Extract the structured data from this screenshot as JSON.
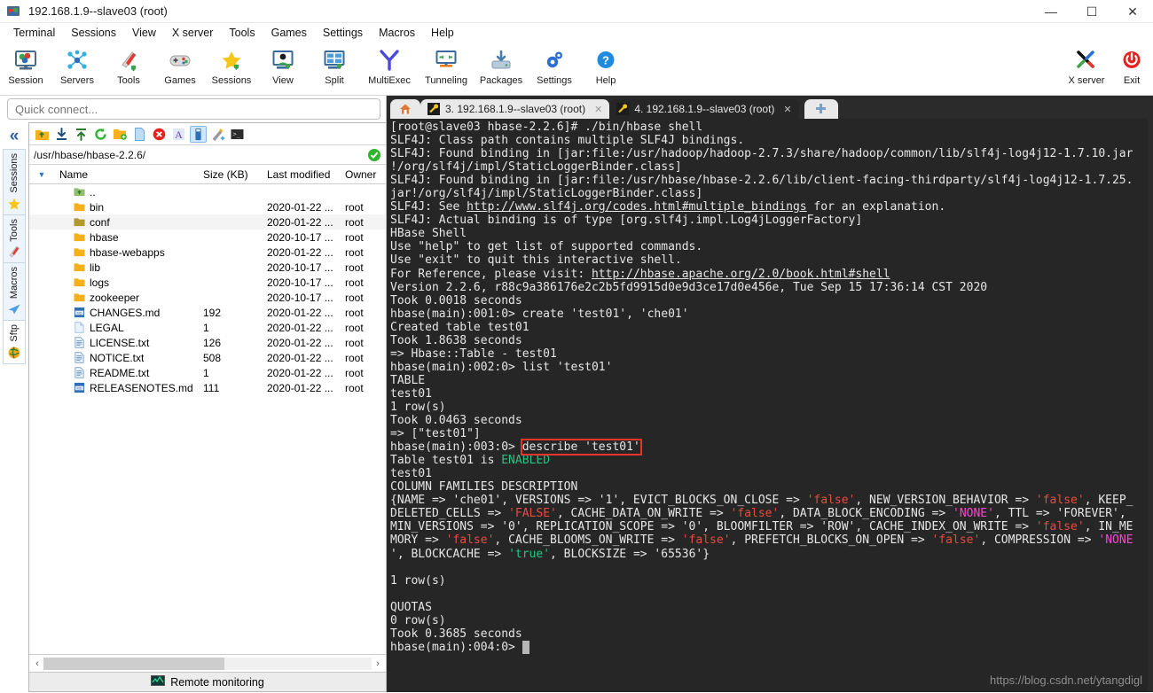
{
  "window": {
    "title": "192.168.1.9--slave03 (root)",
    "icon": "mobaxterm-icon",
    "buttons": [
      {
        "name": "minimize-button",
        "glyph": "—"
      },
      {
        "name": "maximize-button",
        "glyph": "☐"
      },
      {
        "name": "close-button",
        "glyph": "✕"
      }
    ]
  },
  "menubar": {
    "items": [
      "Terminal",
      "Sessions",
      "View",
      "X server",
      "Tools",
      "Games",
      "Settings",
      "Macros",
      "Help"
    ]
  },
  "toolbar": {
    "left": [
      {
        "label": "Session",
        "icon": "session-icon"
      },
      {
        "label": "Servers",
        "icon": "servers-icon"
      },
      {
        "label": "Tools",
        "icon": "tools-icon"
      },
      {
        "label": "Games",
        "icon": "games-icon"
      },
      {
        "label": "Sessions",
        "icon": "sessions-star-icon"
      },
      {
        "label": "View",
        "icon": "view-icon"
      },
      {
        "label": "Split",
        "icon": "split-icon"
      },
      {
        "label": "MultiExec",
        "icon": "multiexec-icon"
      },
      {
        "label": "Tunneling",
        "icon": "tunneling-icon"
      },
      {
        "label": "Packages",
        "icon": "packages-icon"
      },
      {
        "label": "Settings",
        "icon": "settings-gear-icon"
      },
      {
        "label": "Help",
        "icon": "help-icon"
      }
    ],
    "right": [
      {
        "label": "X server",
        "icon": "xserver-icon"
      },
      {
        "label": "Exit",
        "icon": "exit-power-icon"
      }
    ]
  },
  "quick_connect": {
    "placeholder": "Quick connect...",
    "value": ""
  },
  "sidebar": {
    "collapse_glyph": "«",
    "tabs": [
      {
        "label": "Sessions",
        "icon": "star-icon",
        "selected": false
      },
      {
        "label": "Tools",
        "icon": "swiss-knife-icon",
        "selected": false
      },
      {
        "label": "Macros",
        "icon": "paper-plane-icon",
        "selected": false
      },
      {
        "label": "Sftp",
        "icon": "globe-icon",
        "selected": true
      }
    ]
  },
  "sftp": {
    "toolbar_icons": [
      {
        "name": "go-up-icon",
        "active": false
      },
      {
        "name": "download-icon",
        "active": false
      },
      {
        "name": "upload-icon",
        "active": false
      },
      {
        "name": "refresh-icon",
        "active": false
      },
      {
        "name": "new-folder-icon",
        "active": false
      },
      {
        "name": "new-file-icon",
        "active": false
      },
      {
        "name": "delete-icon",
        "active": false
      },
      {
        "name": "text-mode-icon",
        "active": false
      },
      {
        "name": "follow-terminal-folder-icon",
        "active": true
      },
      {
        "name": "quick-edit-icon",
        "active": false
      },
      {
        "name": "open-terminal-icon",
        "active": false
      }
    ],
    "path": "/usr/hbase/hbase-2.2.6/",
    "path_status": "ok-check-icon",
    "columns": [
      "Name",
      "Size (KB)",
      "Last modified",
      "Owner"
    ],
    "rows": [
      {
        "name": "..",
        "icon": "parent-dir-icon",
        "size": "",
        "modified": "",
        "owner": ""
      },
      {
        "name": "bin",
        "icon": "folder-icon",
        "size": "",
        "modified": "2020-01-22 ...",
        "owner": "root"
      },
      {
        "name": "conf",
        "icon": "folder-icon",
        "size": "",
        "modified": "2020-01-22 ...",
        "owner": "root",
        "selected": true
      },
      {
        "name": "hbase",
        "icon": "folder-icon",
        "size": "",
        "modified": "2020-10-17 ...",
        "owner": "root"
      },
      {
        "name": "hbase-webapps",
        "icon": "folder-icon",
        "size": "",
        "modified": "2020-01-22 ...",
        "owner": "root"
      },
      {
        "name": "lib",
        "icon": "folder-icon",
        "size": "",
        "modified": "2020-10-17 ...",
        "owner": "root"
      },
      {
        "name": "logs",
        "icon": "folder-icon",
        "size": "",
        "modified": "2020-10-17 ...",
        "owner": "root"
      },
      {
        "name": "zookeeper",
        "icon": "folder-icon",
        "size": "",
        "modified": "2020-10-17 ...",
        "owner": "root"
      },
      {
        "name": "CHANGES.md",
        "icon": "md-file-icon",
        "size": "192",
        "modified": "2020-01-22 ...",
        "owner": "root"
      },
      {
        "name": "LEGAL",
        "icon": "blank-file-icon",
        "size": "1",
        "modified": "2020-01-22 ...",
        "owner": "root"
      },
      {
        "name": "LICENSE.txt",
        "icon": "text-file-icon",
        "size": "126",
        "modified": "2020-01-22 ...",
        "owner": "root"
      },
      {
        "name": "NOTICE.txt",
        "icon": "text-file-icon",
        "size": "508",
        "modified": "2020-01-22 ...",
        "owner": "root"
      },
      {
        "name": "README.txt",
        "icon": "text-file-icon",
        "size": "1",
        "modified": "2020-01-22 ...",
        "owner": "root"
      },
      {
        "name": "RELEASENOTES.md",
        "icon": "md-file-icon",
        "size": "111",
        "modified": "2020-01-22 ...",
        "owner": "root"
      }
    ],
    "hscroll": {
      "left_arrow": "‹",
      "right_arrow": "›"
    },
    "bottom_strip": {
      "label": "Remote monitoring",
      "icon": "monitor-icon"
    }
  },
  "terminal": {
    "tabs": [
      {
        "label": "",
        "icon": "home-icon",
        "state": "home"
      },
      {
        "label": "3. 192.168.1.9--slave03 (root)",
        "icon": "ssh-key-icon",
        "state": "inactive",
        "close": "✕"
      },
      {
        "label": "4. 192.168.1.9--slave03 (root)",
        "icon": "ssh-key-icon",
        "state": "active",
        "close": "✕"
      },
      {
        "label": "+",
        "icon": "new-tab-icon",
        "state": "newtab"
      }
    ],
    "watermark": "https://blog.csdn.net/ytangdigl",
    "highlight_color": "#e8342a",
    "lines": [
      [
        {
          "t": "[root@slave03 hbase-2.2.6]# ./bin/hbase shell"
        }
      ],
      [
        {
          "t": "SLF4J: Class path contains multiple SLF4J bindings."
        }
      ],
      [
        {
          "t": "SLF4J: Found binding in [jar:file:/usr/hadoop/hadoop-2.7.3/share/hadoop/common/lib/slf4j-log4j12-1.7.10.jar"
        }
      ],
      [
        {
          "t": "!/org/slf4j/impl/StaticLoggerBinder.class]"
        }
      ],
      [
        {
          "t": "SLF4J: Found binding in [jar:file:/usr/hbase/hbase-2.2.6/lib/client-facing-thirdparty/slf4j-log4j12-1.7.25."
        }
      ],
      [
        {
          "t": "jar!/org/slf4j/impl/StaticLoggerBinder.class]"
        }
      ],
      [
        {
          "t": "SLF4J: See "
        },
        {
          "t": "http://www.slf4j.org/codes.html#multiple_bindings",
          "c": "u"
        },
        {
          "t": " for an explanation."
        }
      ],
      [
        {
          "t": "SLF4J: Actual binding is of type [org.slf4j.impl.Log4jLoggerFactory]"
        }
      ],
      [
        {
          "t": "HBase Shell"
        }
      ],
      [
        {
          "t": "Use \"help\" to get list of supported commands."
        }
      ],
      [
        {
          "t": "Use \"exit\" to quit this interactive shell."
        }
      ],
      [
        {
          "t": "For Reference, please visit: "
        },
        {
          "t": "http://hbase.apache.org/2.0/book.html#shell",
          "c": "u"
        }
      ],
      [
        {
          "t": "Version 2.2.6, r88c9a386176e2c2b5fd9915d0e9d3ce17d0e456e, Tue Sep 15 17:36:14 CST 2020"
        }
      ],
      [
        {
          "t": "Took 0.0018 seconds"
        }
      ],
      [
        {
          "t": "hbase(main):001:0> create 'test01', 'che01'"
        }
      ],
      [
        {
          "t": "Created table test01"
        }
      ],
      [
        {
          "t": "Took 1.8638 seconds"
        }
      ],
      [
        {
          "t": "=> Hbase::Table - test01"
        }
      ],
      [
        {
          "t": "hbase(main):002:0> list 'test01'"
        }
      ],
      [
        {
          "t": "TABLE"
        }
      ],
      [
        {
          "t": "test01"
        }
      ],
      [
        {
          "t": "1 row(s)"
        }
      ],
      [
        {
          "t": "Took 0.0463 seconds"
        }
      ],
      [
        {
          "t": "=> [\"test01\"]"
        }
      ],
      [
        {
          "t": "hbase(main):003:0> "
        },
        {
          "t": "describe 'test01'",
          "c": "hl"
        }
      ],
      [
        {
          "t": "Table test01 is "
        },
        {
          "t": "ENABLED",
          "c": "g"
        }
      ],
      [
        {
          "t": "test01"
        }
      ],
      [
        {
          "t": "COLUMN FAMILIES DESCRIPTION"
        }
      ],
      [
        {
          "t": "{NAME => 'che01', VERSIONS => '1', EVICT_BLOCKS_ON_CLOSE => "
        },
        {
          "t": "'false'",
          "c": "r"
        },
        {
          "t": ", NEW_VERSION_BEHAVIOR => "
        },
        {
          "t": "'false'",
          "c": "r"
        },
        {
          "t": ", KEEP_"
        }
      ],
      [
        {
          "t": "DELETED_CELLS => "
        },
        {
          "t": "'FALSE'",
          "c": "r"
        },
        {
          "t": ", CACHE_DATA_ON_WRITE => "
        },
        {
          "t": "'false'",
          "c": "r"
        },
        {
          "t": ", DATA_BLOCK_ENCODING => "
        },
        {
          "t": "'NONE'",
          "c": "m"
        },
        {
          "t": ", TTL => 'FOREVER', "
        }
      ],
      [
        {
          "t": "MIN_VERSIONS => '0', REPLICATION_SCOPE => '0', BLOOMFILTER => 'ROW', CACHE_INDEX_ON_WRITE => "
        },
        {
          "t": "'false'",
          "c": "r"
        },
        {
          "t": ", IN_ME"
        }
      ],
      [
        {
          "t": "MORY => "
        },
        {
          "t": "'false'",
          "c": "r"
        },
        {
          "t": ", CACHE_BLOOMS_ON_WRITE => "
        },
        {
          "t": "'false'",
          "c": "r"
        },
        {
          "t": ", PREFETCH_BLOCKS_ON_OPEN => "
        },
        {
          "t": "'false'",
          "c": "r"
        },
        {
          "t": ", COMPRESSION => "
        },
        {
          "t": "'NONE",
          "c": "m"
        }
      ],
      [
        {
          "t": "', BLOCKCACHE => "
        },
        {
          "t": "'true'",
          "c": "g"
        },
        {
          "t": ", BLOCKSIZE => '65536'}"
        }
      ],
      [
        {
          "t": ""
        }
      ],
      [
        {
          "t": "1 row(s)"
        }
      ],
      [
        {
          "t": ""
        }
      ],
      [
        {
          "t": "QUOTAS"
        }
      ],
      [
        {
          "t": "0 row(s)"
        }
      ],
      [
        {
          "t": "Took 0.3685 seconds"
        }
      ],
      [
        {
          "t": "hbase(main):004:0> "
        },
        {
          "t": " ",
          "c": "cursor"
        }
      ]
    ]
  }
}
